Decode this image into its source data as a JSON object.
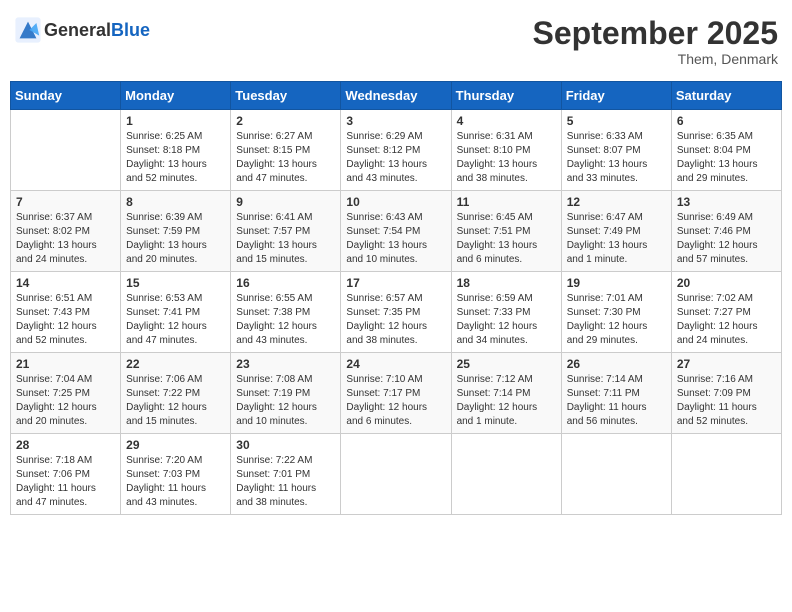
{
  "header": {
    "logo_general": "General",
    "logo_blue": "Blue",
    "month": "September 2025",
    "location": "Them, Denmark"
  },
  "weekdays": [
    "Sunday",
    "Monday",
    "Tuesday",
    "Wednesday",
    "Thursday",
    "Friday",
    "Saturday"
  ],
  "weeks": [
    [
      {
        "day": "",
        "info": ""
      },
      {
        "day": "1",
        "info": "Sunrise: 6:25 AM\nSunset: 8:18 PM\nDaylight: 13 hours\nand 52 minutes."
      },
      {
        "day": "2",
        "info": "Sunrise: 6:27 AM\nSunset: 8:15 PM\nDaylight: 13 hours\nand 47 minutes."
      },
      {
        "day": "3",
        "info": "Sunrise: 6:29 AM\nSunset: 8:12 PM\nDaylight: 13 hours\nand 43 minutes."
      },
      {
        "day": "4",
        "info": "Sunrise: 6:31 AM\nSunset: 8:10 PM\nDaylight: 13 hours\nand 38 minutes."
      },
      {
        "day": "5",
        "info": "Sunrise: 6:33 AM\nSunset: 8:07 PM\nDaylight: 13 hours\nand 33 minutes."
      },
      {
        "day": "6",
        "info": "Sunrise: 6:35 AM\nSunset: 8:04 PM\nDaylight: 13 hours\nand 29 minutes."
      }
    ],
    [
      {
        "day": "7",
        "info": "Sunrise: 6:37 AM\nSunset: 8:02 PM\nDaylight: 13 hours\nand 24 minutes."
      },
      {
        "day": "8",
        "info": "Sunrise: 6:39 AM\nSunset: 7:59 PM\nDaylight: 13 hours\nand 20 minutes."
      },
      {
        "day": "9",
        "info": "Sunrise: 6:41 AM\nSunset: 7:57 PM\nDaylight: 13 hours\nand 15 minutes."
      },
      {
        "day": "10",
        "info": "Sunrise: 6:43 AM\nSunset: 7:54 PM\nDaylight: 13 hours\nand 10 minutes."
      },
      {
        "day": "11",
        "info": "Sunrise: 6:45 AM\nSunset: 7:51 PM\nDaylight: 13 hours\nand 6 minutes."
      },
      {
        "day": "12",
        "info": "Sunrise: 6:47 AM\nSunset: 7:49 PM\nDaylight: 13 hours\nand 1 minute."
      },
      {
        "day": "13",
        "info": "Sunrise: 6:49 AM\nSunset: 7:46 PM\nDaylight: 12 hours\nand 57 minutes."
      }
    ],
    [
      {
        "day": "14",
        "info": "Sunrise: 6:51 AM\nSunset: 7:43 PM\nDaylight: 12 hours\nand 52 minutes."
      },
      {
        "day": "15",
        "info": "Sunrise: 6:53 AM\nSunset: 7:41 PM\nDaylight: 12 hours\nand 47 minutes."
      },
      {
        "day": "16",
        "info": "Sunrise: 6:55 AM\nSunset: 7:38 PM\nDaylight: 12 hours\nand 43 minutes."
      },
      {
        "day": "17",
        "info": "Sunrise: 6:57 AM\nSunset: 7:35 PM\nDaylight: 12 hours\nand 38 minutes."
      },
      {
        "day": "18",
        "info": "Sunrise: 6:59 AM\nSunset: 7:33 PM\nDaylight: 12 hours\nand 34 minutes."
      },
      {
        "day": "19",
        "info": "Sunrise: 7:01 AM\nSunset: 7:30 PM\nDaylight: 12 hours\nand 29 minutes."
      },
      {
        "day": "20",
        "info": "Sunrise: 7:02 AM\nSunset: 7:27 PM\nDaylight: 12 hours\nand 24 minutes."
      }
    ],
    [
      {
        "day": "21",
        "info": "Sunrise: 7:04 AM\nSunset: 7:25 PM\nDaylight: 12 hours\nand 20 minutes."
      },
      {
        "day": "22",
        "info": "Sunrise: 7:06 AM\nSunset: 7:22 PM\nDaylight: 12 hours\nand 15 minutes."
      },
      {
        "day": "23",
        "info": "Sunrise: 7:08 AM\nSunset: 7:19 PM\nDaylight: 12 hours\nand 10 minutes."
      },
      {
        "day": "24",
        "info": "Sunrise: 7:10 AM\nSunset: 7:17 PM\nDaylight: 12 hours\nand 6 minutes."
      },
      {
        "day": "25",
        "info": "Sunrise: 7:12 AM\nSunset: 7:14 PM\nDaylight: 12 hours\nand 1 minute."
      },
      {
        "day": "26",
        "info": "Sunrise: 7:14 AM\nSunset: 7:11 PM\nDaylight: 11 hours\nand 56 minutes."
      },
      {
        "day": "27",
        "info": "Sunrise: 7:16 AM\nSunset: 7:09 PM\nDaylight: 11 hours\nand 52 minutes."
      }
    ],
    [
      {
        "day": "28",
        "info": "Sunrise: 7:18 AM\nSunset: 7:06 PM\nDaylight: 11 hours\nand 47 minutes."
      },
      {
        "day": "29",
        "info": "Sunrise: 7:20 AM\nSunset: 7:03 PM\nDaylight: 11 hours\nand 43 minutes."
      },
      {
        "day": "30",
        "info": "Sunrise: 7:22 AM\nSunset: 7:01 PM\nDaylight: 11 hours\nand 38 minutes."
      },
      {
        "day": "",
        "info": ""
      },
      {
        "day": "",
        "info": ""
      },
      {
        "day": "",
        "info": ""
      },
      {
        "day": "",
        "info": ""
      }
    ]
  ]
}
